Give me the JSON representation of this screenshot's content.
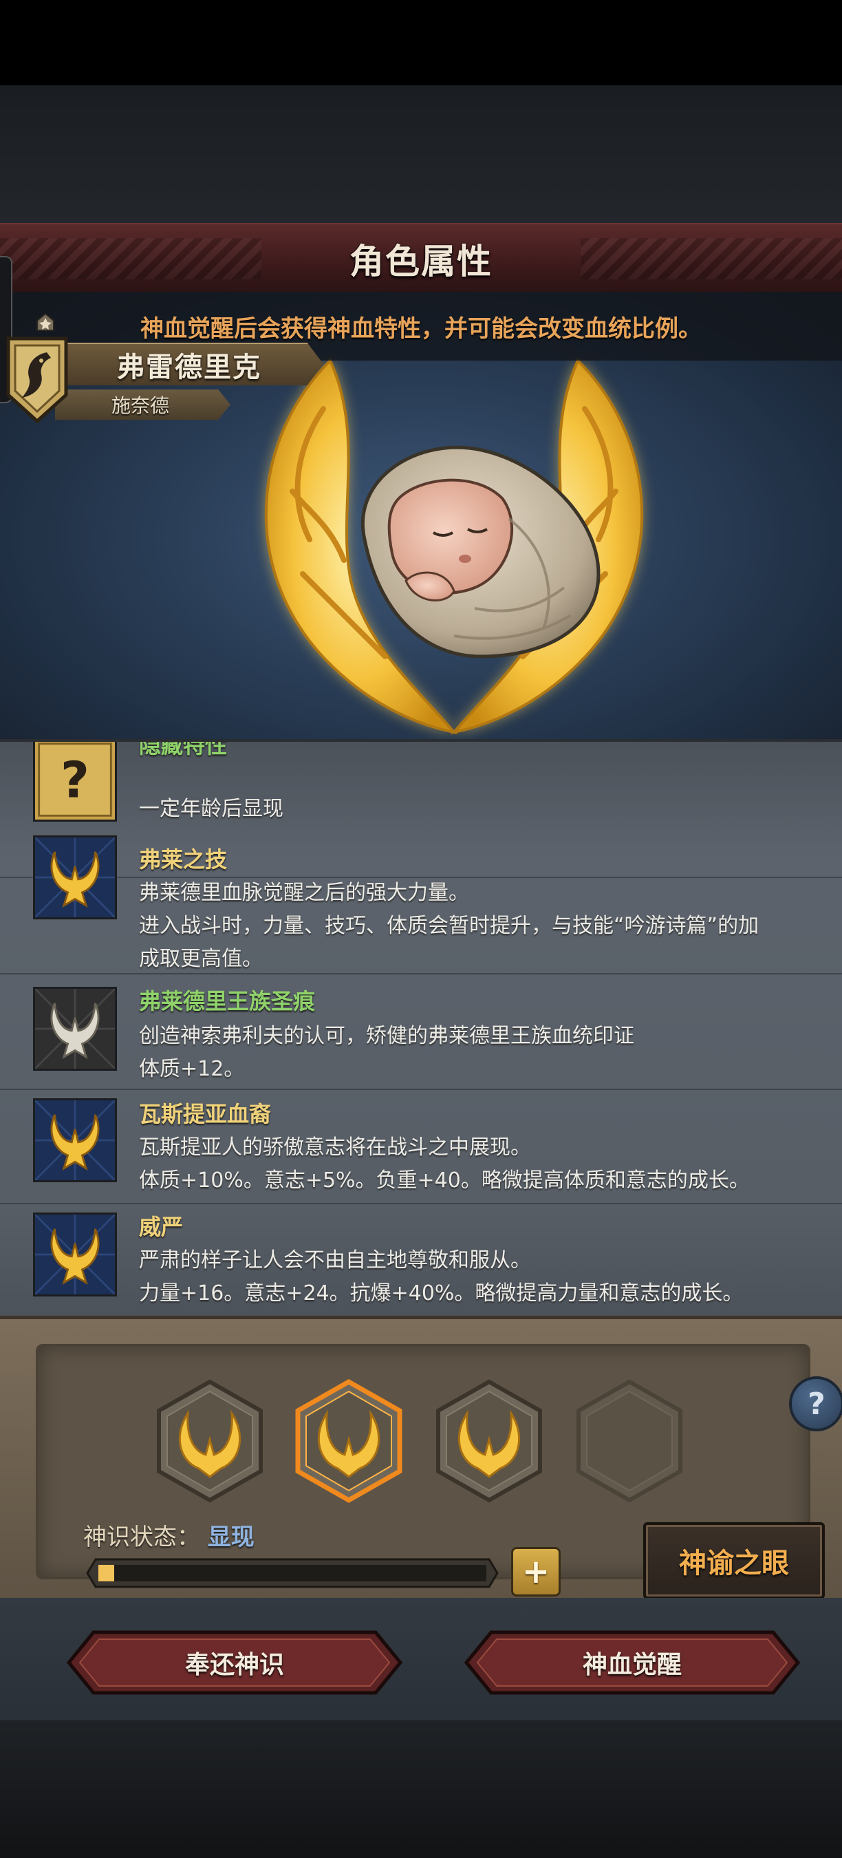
{
  "title": "角色属性",
  "notice": "神血觉醒后会获得神血特性，并可能会改变血统比例。",
  "hero": {
    "name": "弗雷德里克",
    "family": "施奈德"
  },
  "traits": [
    {
      "title": "隐藏特性",
      "title_color": "green",
      "icon": "question-icon",
      "lines": [
        "一定年龄后显现"
      ]
    },
    {
      "title": "弗莱之技",
      "title_color": "gold",
      "icon": "blue-horn-crest-icon",
      "lines": [
        "弗莱德里血脉觉醒之后的强大力量。",
        "进入战斗时，力量、技巧、体质会暂时提升，与技能“吟游诗篇”的加",
        "成取更高值。"
      ]
    },
    {
      "title": "弗莱德里王族圣痕",
      "title_color": "green",
      "icon": "silver-horn-crest-icon",
      "lines": [
        "创造神索弗利夫的认可，矫健的弗莱德里王族血统印证",
        "体质+12。"
      ]
    },
    {
      "title": "瓦斯提亚血裔",
      "title_color": "gold",
      "icon": "blue-horn-crest-icon",
      "lines": [
        "瓦斯提亚人的骄傲意志将在战斗之中展现。",
        "体质+10%。意志+5%。负重+40。略微提高体质和意志的成长。"
      ]
    },
    {
      "title": "威严",
      "title_color": "gold",
      "icon": "blue-horn-crest-icon",
      "lines": [
        "严肃的样子让人会不由自主地尊敬和服从。",
        "力量+16。意志+24。抗爆+40%。略微提高力量和意志的成长。"
      ]
    }
  ],
  "slots": [
    {
      "state": "filled"
    },
    {
      "state": "selected"
    },
    {
      "state": "filled"
    },
    {
      "state": "empty"
    }
  ],
  "status": {
    "label": "神识状态：",
    "value": "显现",
    "progress": 0.04
  },
  "buttons": {
    "help": "?",
    "plus": "+",
    "oracle": "神谕之眼",
    "return": "奉还神识",
    "awaken": "神血觉醒"
  },
  "colors": {
    "gold": "#f0d27a",
    "green": "#8fd26a",
    "notice": "#e8a45a",
    "status_value": "#8fb3e0",
    "oracle": "#f3ae4f"
  }
}
